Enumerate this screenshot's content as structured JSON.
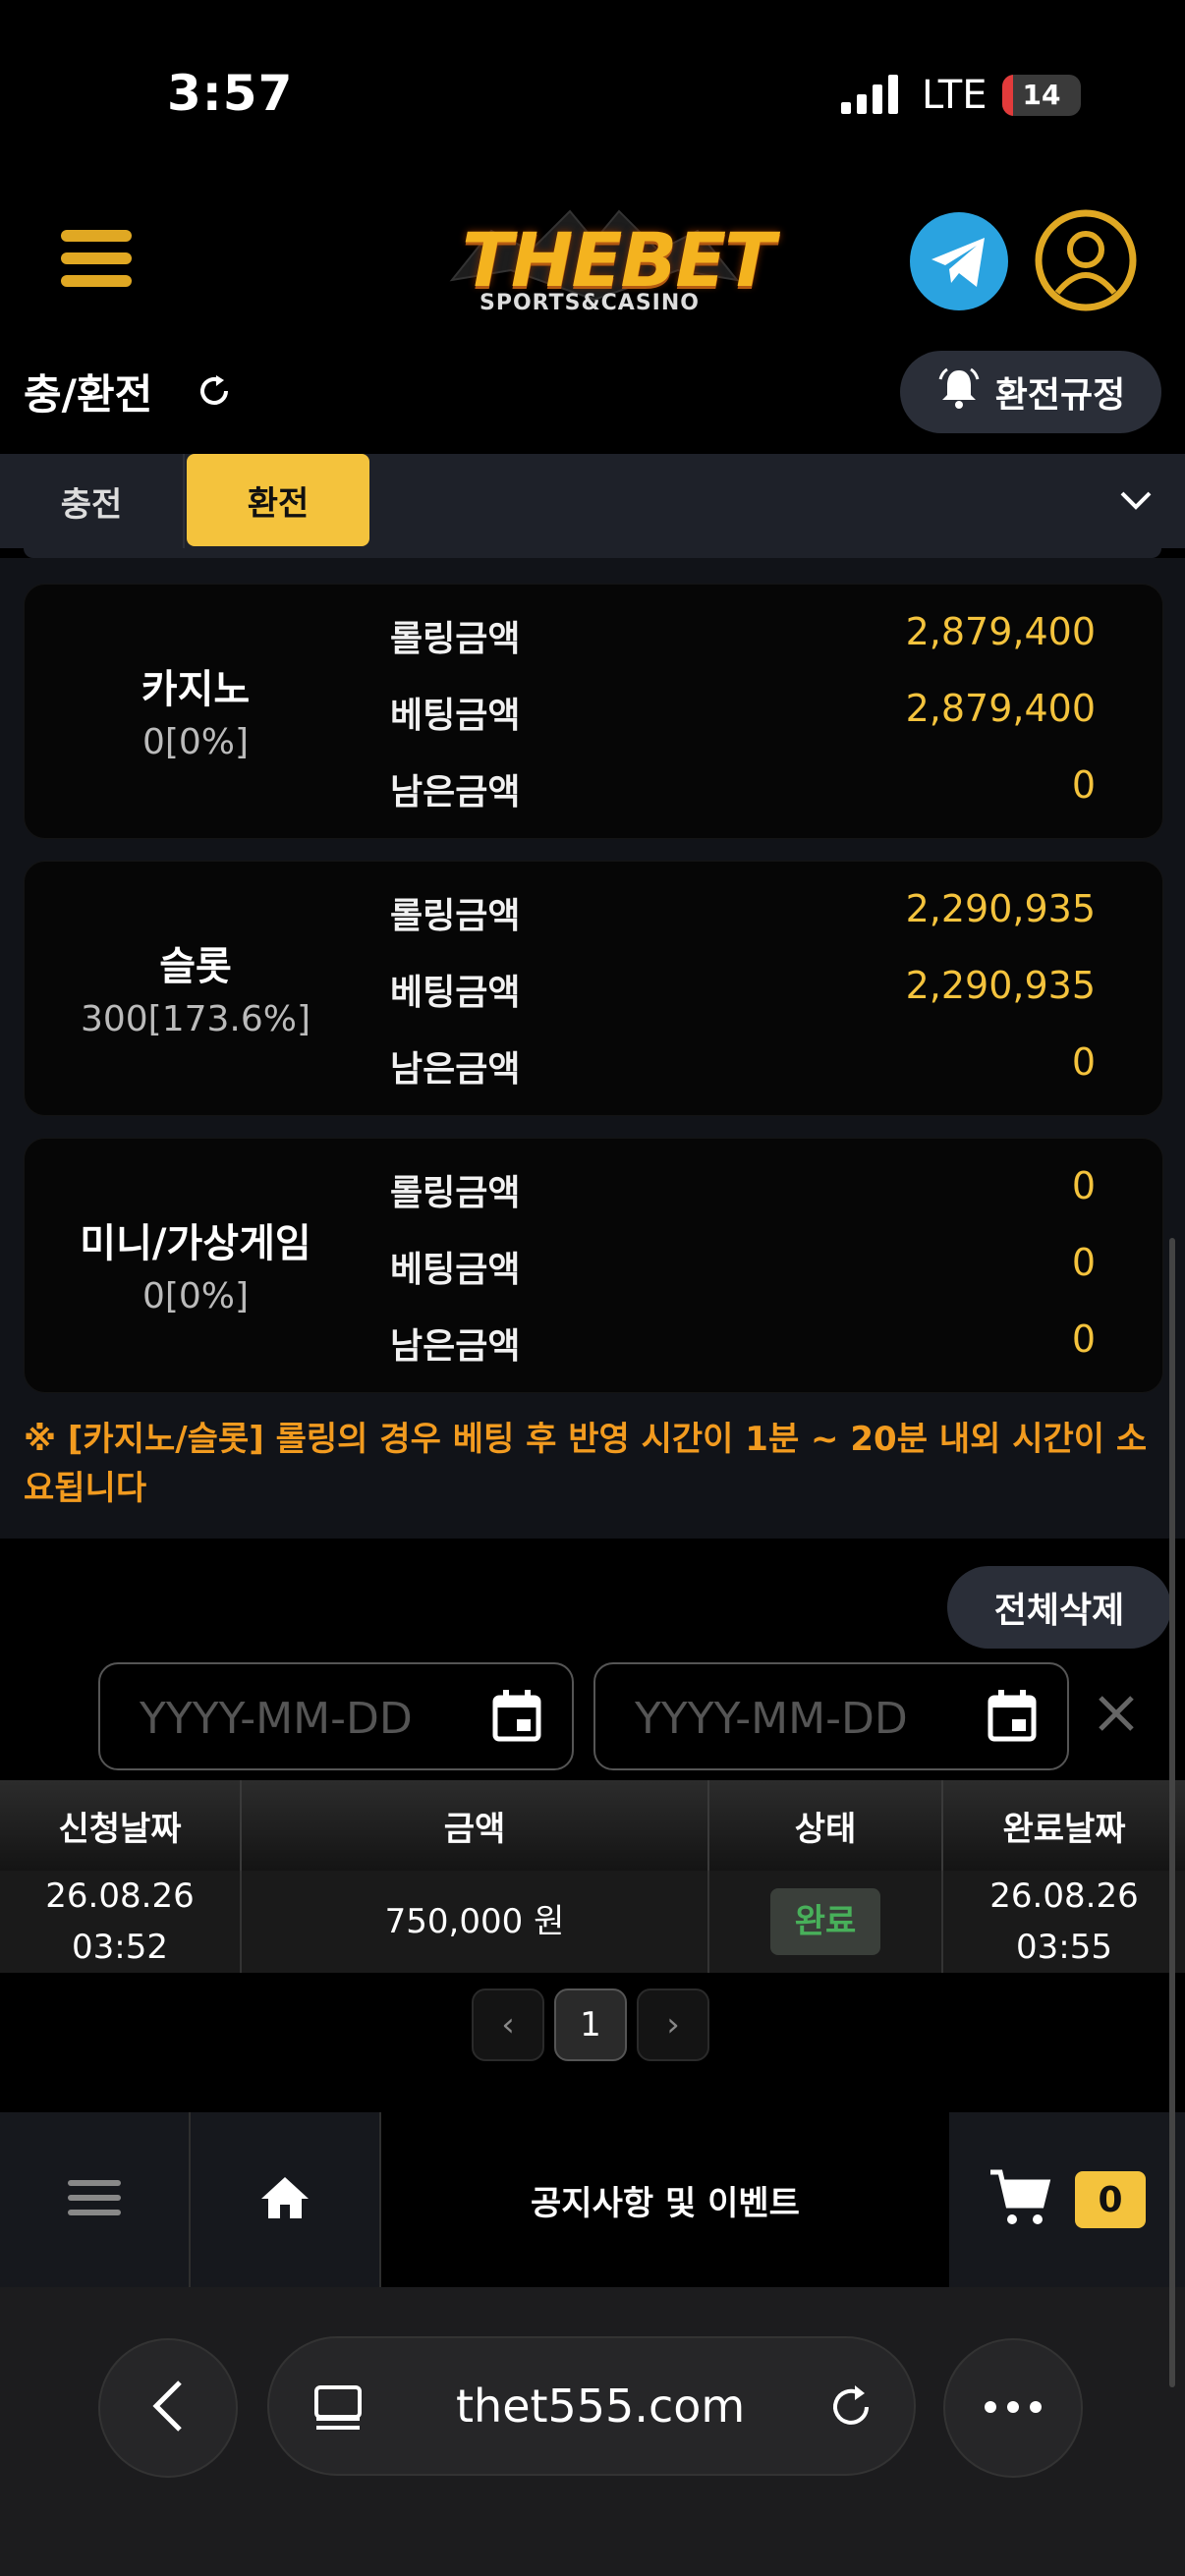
{
  "status_bar": {
    "time": "3:57",
    "network": "LTE",
    "battery": "14",
    "battery_level": 0.14
  },
  "header": {
    "logo_text": "THEBET",
    "logo_sub": "SPORTS&CASINO",
    "menu_icon": "hamburger-icon",
    "telegram_icon": "telegram-icon",
    "profile_icon": "user-icon"
  },
  "page": {
    "title": "충/환전",
    "rules_label": "환전규정"
  },
  "tabs": {
    "deposit": "충전",
    "withdraw": "환전",
    "active": "withdraw"
  },
  "rolling": {
    "labels": {
      "rolling": "롤링금액",
      "betting": "베팅금액",
      "remaining": "남은금액"
    },
    "cards": [
      {
        "name": "카지노",
        "sub": "0[0%]",
        "rolling": "2,879,400",
        "betting": "2,879,400",
        "remaining": "0"
      },
      {
        "name": "슬롯",
        "sub": "300[173.6%]",
        "rolling": "2,290,935",
        "betting": "2,290,935",
        "remaining": "0"
      },
      {
        "name": "미니/가상게임",
        "sub": "0[0%]",
        "rolling": "0",
        "betting": "0",
        "remaining": "0"
      }
    ]
  },
  "notice": "※ [카지노/슬롯] 롤링의 경우 베팅 후 반영 시간이 1분 ~ 20분 내외 시간이 소요됩니다",
  "history": {
    "delete_all_label": "전체삭제",
    "start_placeholder": "YYYY-MM-DD",
    "end_placeholder": "YYYY-MM-DD",
    "columns": {
      "request_date": "신청날짜",
      "amount": "금액",
      "status": "상태",
      "complete_date": "완료날짜"
    },
    "rows": [
      {
        "request_date": "26.08.26",
        "request_time": "03:52",
        "amount": "750,000 원",
        "status": "완료",
        "complete_date": "26.08.26",
        "complete_time": "03:55"
      }
    ],
    "pagination": {
      "prev": "‹",
      "current": "1",
      "next": "›"
    }
  },
  "bottom_nav": {
    "notice_label": "공지사항 및 이벤트",
    "cart_count": "0"
  },
  "browser": {
    "url": "thet555.com"
  },
  "colors": {
    "accent": "#f4c33d",
    "notice": "#f29b1f",
    "status_done": "#48b05a",
    "telegram": "#2aa3e0"
  }
}
